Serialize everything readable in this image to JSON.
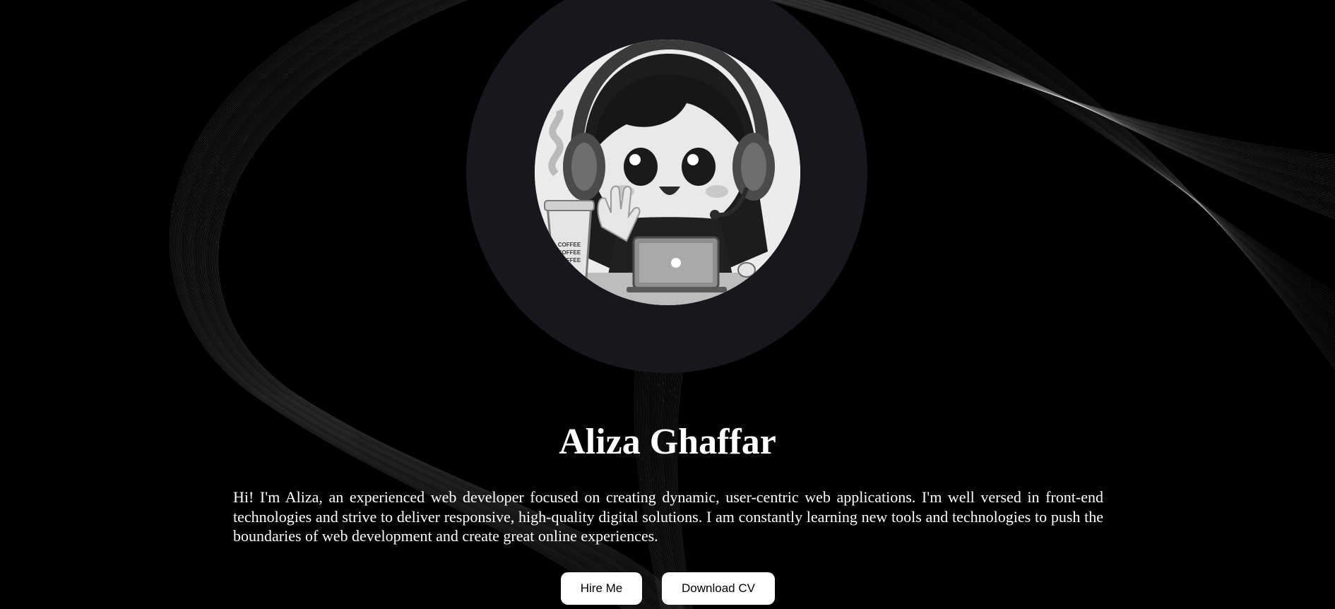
{
  "hero": {
    "name": "Aliza Ghaffar",
    "bio": "Hi! I'm Aliza, an experienced web developer focused on creating dynamic, user-centric web applications. I'm well versed in front-end technologies and strive to deliver responsive, high-quality digital solutions. I am constantly learning new tools and technologies to push the boundaries of web development and create great online experiences.",
    "buttons": {
      "hire_label": "Hire Me",
      "cv_label": "Download CV"
    }
  },
  "avatar": {
    "cup_text": [
      "COFFEE",
      "COFFEE",
      "COFFEE"
    ]
  },
  "colors": {
    "background": "#000000",
    "avatar_ring": "#17181d",
    "button_bg": "#ffffff",
    "text": "#ffffff"
  }
}
